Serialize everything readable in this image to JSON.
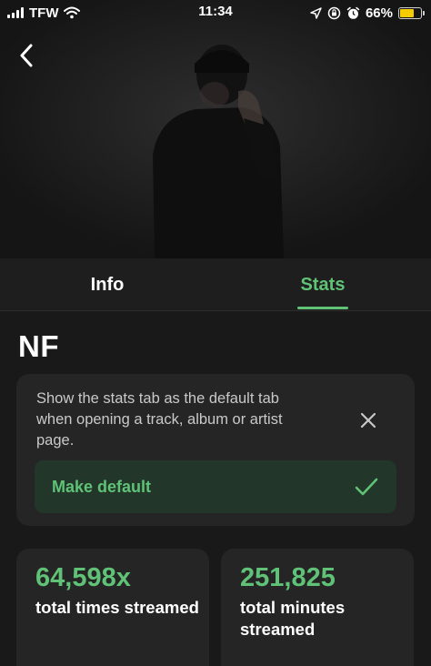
{
  "status_bar": {
    "carrier": "TFW",
    "time": "11:34",
    "battery_percent": "66%",
    "battery_level": 0.66,
    "battery_color": "#f5cc00"
  },
  "header": {
    "back_icon": "chevron-left-icon"
  },
  "tabs": [
    {
      "label": "Info",
      "active": false
    },
    {
      "label": "Stats",
      "active": true
    }
  ],
  "artist": {
    "name": "NF"
  },
  "default_tab_tip": {
    "message": "Show the stats tab as the default tab when opening a track, album or artist page.",
    "dismiss_icon": "close-icon",
    "button_label": "Make default",
    "button_icon": "checkmark-icon"
  },
  "stats": [
    {
      "value": "64,598x",
      "label": "total times streamed"
    },
    {
      "value": "251,825",
      "label": "total minutes streamed"
    }
  ],
  "colors": {
    "accent": "#5fc276",
    "background": "#191919",
    "card": "#252525",
    "button_bg": "#22372a"
  }
}
